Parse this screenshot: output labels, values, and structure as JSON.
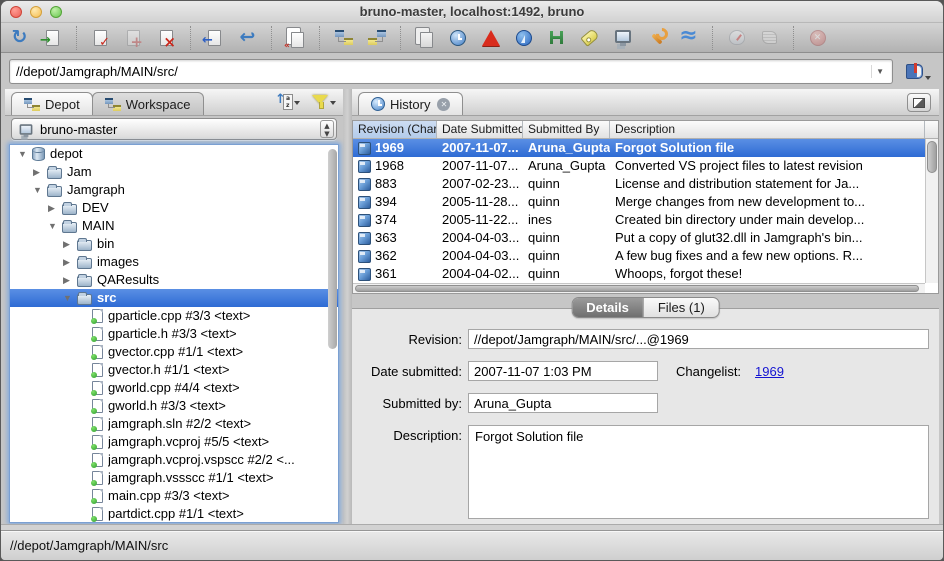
{
  "window": {
    "title": "bruno-master,  localhost:1492,  bruno"
  },
  "toolbar": {
    "buttons": [
      {
        "name": "refresh",
        "disabled": false
      },
      {
        "name": "get-latest-revision",
        "disabled": false
      },
      {
        "name": "separator"
      },
      {
        "name": "checkout",
        "disabled": false
      },
      {
        "name": "mark-for-add",
        "disabled": true
      },
      {
        "name": "mark-for-delete",
        "disabled": false
      },
      {
        "name": "separator"
      },
      {
        "name": "submit",
        "disabled": false
      },
      {
        "name": "revert",
        "disabled": false
      },
      {
        "name": "separator"
      },
      {
        "name": "diff",
        "disabled": false
      },
      {
        "name": "separator"
      },
      {
        "name": "branch-mapping",
        "disabled": false
      },
      {
        "name": "integrate",
        "disabled": false
      },
      {
        "name": "separator"
      },
      {
        "name": "duplicate",
        "disabled": false
      },
      {
        "name": "time-lapse-view",
        "disabled": false
      },
      {
        "name": "revision-graph",
        "disabled": false
      },
      {
        "name": "merge-tool",
        "disabled": false
      },
      {
        "name": "branch-view",
        "disabled": false
      },
      {
        "name": "label",
        "disabled": false
      },
      {
        "name": "workspace",
        "disabled": false
      },
      {
        "name": "administration",
        "disabled": false
      },
      {
        "name": "streams",
        "disabled": false
      },
      {
        "name": "separator"
      },
      {
        "name": "dashboard",
        "disabled": true
      },
      {
        "name": "activity-log",
        "disabled": true
      },
      {
        "name": "separator"
      },
      {
        "name": "stop",
        "disabled": true
      }
    ]
  },
  "address_bar": {
    "value": "//depot/Jamgraph/MAIN/src/"
  },
  "left_panel": {
    "tabs": [
      {
        "label": "Depot"
      },
      {
        "label": "Workspace"
      }
    ],
    "workspace_selector": "bruno-master",
    "tree": [
      {
        "label": "depot",
        "type": "depot",
        "state": "expanded",
        "level": 0
      },
      {
        "label": "Jam",
        "type": "folder",
        "state": "collapsed",
        "level": 1
      },
      {
        "label": "Jamgraph",
        "type": "folder",
        "state": "expanded",
        "level": 1
      },
      {
        "label": "DEV",
        "type": "folder",
        "state": "collapsed",
        "level": 2
      },
      {
        "label": "MAIN",
        "type": "folder",
        "state": "expanded",
        "level": 2
      },
      {
        "label": "bin",
        "type": "folder",
        "state": "collapsed",
        "level": 3
      },
      {
        "label": "images",
        "type": "folder",
        "state": "collapsed",
        "level": 3
      },
      {
        "label": "QAResults",
        "type": "folder",
        "state": "collapsed",
        "level": 3
      },
      {
        "label": "src",
        "type": "folder",
        "state": "expanded",
        "level": 3,
        "selected": true
      },
      {
        "label": "gparticle.cpp #3/3 <text>",
        "type": "file",
        "level": 4
      },
      {
        "label": "gparticle.h #3/3 <text>",
        "type": "file",
        "level": 4
      },
      {
        "label": "gvector.cpp #1/1 <text>",
        "type": "file",
        "level": 4
      },
      {
        "label": "gvector.h #1/1 <text>",
        "type": "file",
        "level": 4
      },
      {
        "label": "gworld.cpp #4/4 <text>",
        "type": "file",
        "level": 4
      },
      {
        "label": "gworld.h #3/3 <text>",
        "type": "file",
        "level": 4
      },
      {
        "label": "jamgraph.sln #2/2 <text>",
        "type": "file",
        "level": 4
      },
      {
        "label": "jamgraph.vcproj #5/5 <text>",
        "type": "file",
        "level": 4
      },
      {
        "label": "jamgraph.vcproj.vspscc #2/2 <...",
        "type": "file",
        "level": 4
      },
      {
        "label": "jamgraph.vssscc #1/1 <text>",
        "type": "file",
        "level": 4
      },
      {
        "label": "main.cpp #3/3 <text>",
        "type": "file",
        "level": 4
      },
      {
        "label": "partdict.cpp #1/1 <text>",
        "type": "file",
        "level": 4
      }
    ]
  },
  "history_panel": {
    "tab_label": "History",
    "columns": [
      "Revision (Char",
      "Date Submitted",
      "Submitted By",
      "Description"
    ],
    "rows": [
      {
        "revision": "1969",
        "date": "2007-11-07...",
        "by": "Aruna_Gupta",
        "desc": "Forgot Solution file",
        "selected": true
      },
      {
        "revision": "1968",
        "date": "2007-11-07...",
        "by": "Aruna_Gupta",
        "desc": "Converted VS project files to latest revision"
      },
      {
        "revision": "883",
        "date": "2007-02-23...",
        "by": "quinn",
        "desc": "License and distribution statement for Ja..."
      },
      {
        "revision": "394",
        "date": "2005-11-28...",
        "by": "quinn",
        "desc": "Merge changes from new development to..."
      },
      {
        "revision": "374",
        "date": "2005-11-22...",
        "by": "ines",
        "desc": "Created bin directory under main develop..."
      },
      {
        "revision": "363",
        "date": "2004-04-03...",
        "by": "quinn",
        "desc": "Put a copy of glut32.dll in Jamgraph's bin..."
      },
      {
        "revision": "362",
        "date": "2004-04-03...",
        "by": "quinn",
        "desc": "A few bug fixes and a few new options. R..."
      },
      {
        "revision": "361",
        "date": "2004-04-02...",
        "by": "quinn",
        "desc": "Whoops, forgot these!"
      }
    ]
  },
  "details_panel": {
    "tabs": [
      "Details",
      "Files (1)"
    ],
    "revision_label": "Revision:",
    "revision_value": "//depot/Jamgraph/MAIN/src/...@1969",
    "date_label": "Date submitted:",
    "date_value": "2007-11-07 1:03 PM",
    "changelist_label": "Changelist:",
    "changelist_value": "1969",
    "submitted_by_label": "Submitted by:",
    "submitted_by_value": "Aruna_Gupta",
    "description_label": "Description:",
    "description_value": "Forgot Solution file"
  },
  "status_bar": {
    "path": "//depot/Jamgraph/MAIN/src"
  }
}
